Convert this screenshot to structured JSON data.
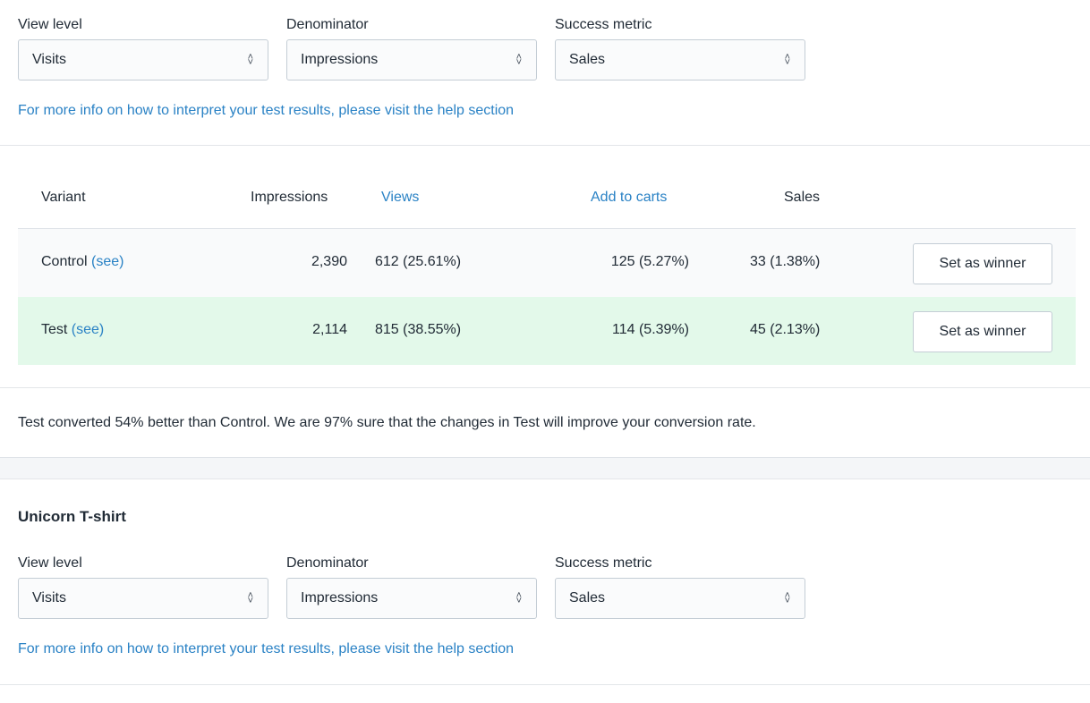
{
  "top_filters": {
    "view_level": {
      "label": "View level",
      "value": "Visits"
    },
    "denominator": {
      "label": "Denominator",
      "value": "Impressions"
    },
    "success_metric": {
      "label": "Success metric",
      "value": "Sales"
    },
    "help_link": "For more info on how to interpret your test results, please visit the help section"
  },
  "table": {
    "headers": {
      "variant": "Variant",
      "impressions": "Impressions",
      "views": "Views",
      "add_to_carts": "Add to carts",
      "sales": "Sales"
    },
    "rows": [
      {
        "variant": "Control",
        "see": "(see)",
        "impressions": "2,390",
        "views": "612 (25.61%)",
        "add_to_carts": "125 (5.27%)",
        "sales": "33 (1.38%)",
        "button": "Set as winner"
      },
      {
        "variant": "Test",
        "see": "(see)",
        "impressions": "2,114",
        "views": "815 (38.55%)",
        "add_to_carts": "114 (5.39%)",
        "sales": "45 (2.13%)",
        "button": "Set as winner"
      }
    ]
  },
  "summary": "Test converted 54% better than Control. We are 97% sure that the changes in Test will improve your conversion rate.",
  "section2": {
    "title": "Unicorn T-shirt",
    "view_level": {
      "label": "View level",
      "value": "Visits"
    },
    "denominator": {
      "label": "Denominator",
      "value": "Impressions"
    },
    "success_metric": {
      "label": "Success metric",
      "value": "Sales"
    },
    "help_link": "For more info on how to interpret your test results, please visit the help section"
  },
  "colors": {
    "link": "#2a82c5",
    "test_row_bg": "#e3f9ea",
    "control_row_bg": "#f9fafb"
  }
}
